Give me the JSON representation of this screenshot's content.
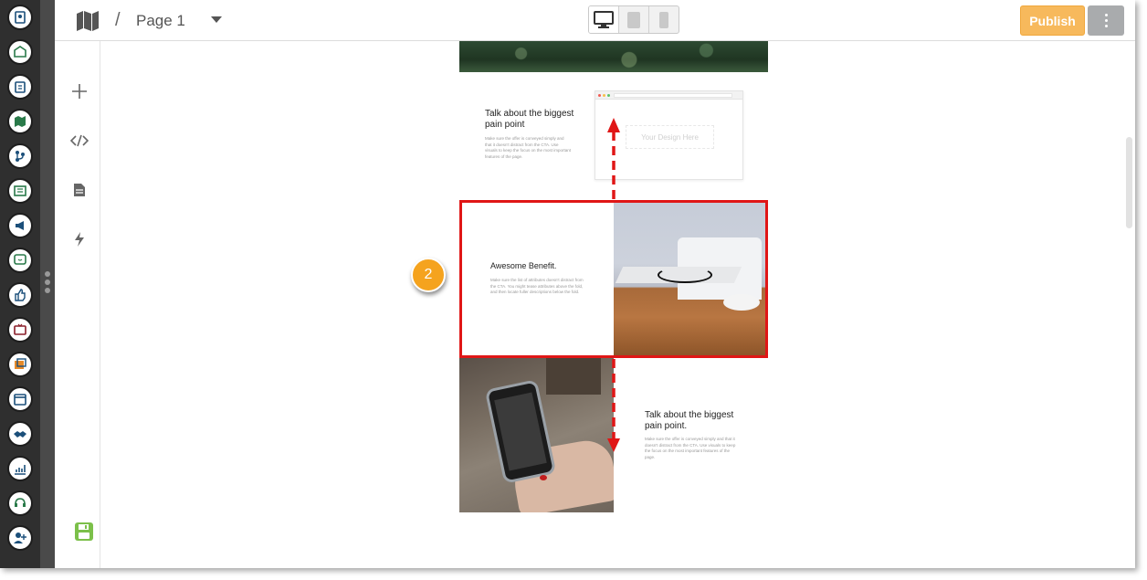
{
  "topbar": {
    "page_name": "Page 1",
    "separator": "/",
    "publish_label": "Publish",
    "devices": [
      "desktop-icon",
      "tablet-icon",
      "mobile-icon"
    ],
    "active_device": "desktop"
  },
  "rail": {
    "icons": [
      "contacts-icon",
      "email-icon",
      "clipboard-icon",
      "map-icon",
      "workflow-icon",
      "list-icon",
      "megaphone-icon",
      "chat-icon",
      "thumbs-up-icon",
      "tv-icon",
      "image-icon",
      "calendar-icon",
      "handshake-icon",
      "analytics-icon",
      "support-icon",
      "add-user-icon"
    ]
  },
  "tools": [
    "plus-icon",
    "code-icon",
    "document-icon",
    "lightning-icon",
    "save-icon"
  ],
  "canvas": {
    "block1": {
      "title": "Talk about the biggest pain point",
      "body": "Make sure the offer is conveyed simply and that it doesn't distract from the CTA. Use visuals to keep the focus on the most important features of the page.",
      "mock_label": "Your Design Here"
    },
    "highlight": {
      "title": "Awesome Benefit.",
      "body": "Make sure the list of attributes doesn't distract from the CTA. You might tease attributes above the fold, and then locate fuller descriptions below the fold."
    },
    "block3": {
      "title": "Talk about the biggest pain point.",
      "body": "Make sure the offer is conveyed simply and that it doesn't distract from the CTA. Use visuals to keep the focus on the most important features of the page."
    },
    "step_badge": "2"
  },
  "colors": {
    "publish": "#f7b95c",
    "highlight": "#e01616",
    "badge": "#f5a31e",
    "rail": "#2f2f2f"
  }
}
